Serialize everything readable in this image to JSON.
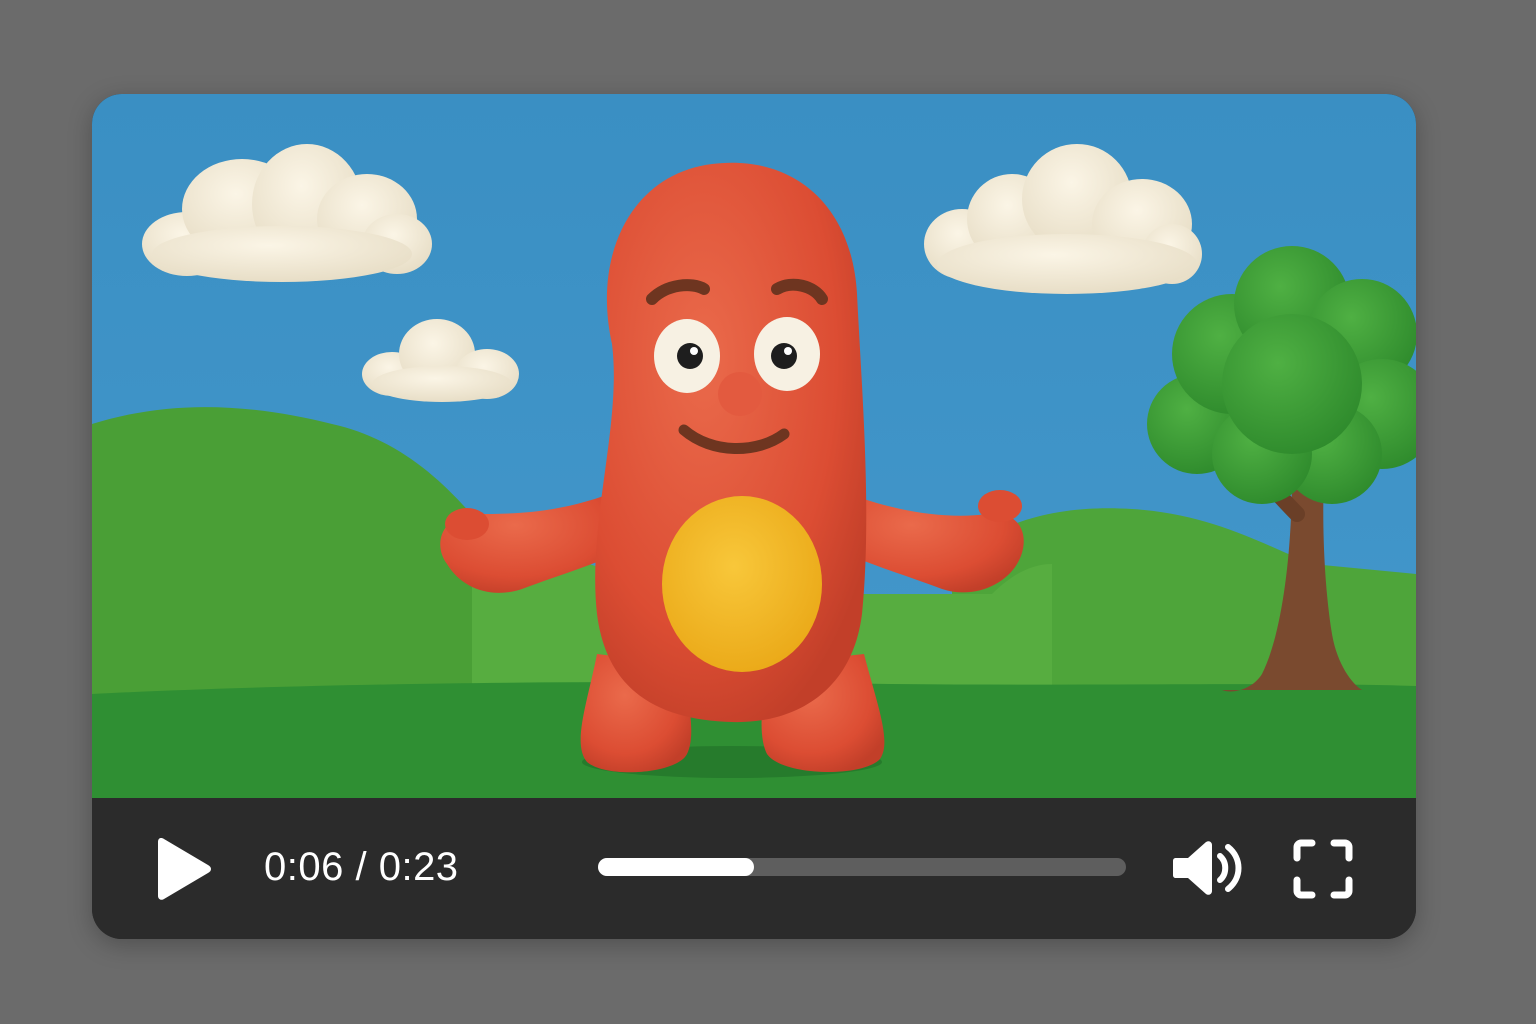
{
  "player": {
    "time": {
      "current": "0:06",
      "separator": " / ",
      "duration": "0:23"
    },
    "progress_fraction": 0.296,
    "controls": {
      "play_icon": "play-icon",
      "volume_icon": "volume-icon",
      "fullscreen_icon": "fullscreen-icon"
    }
  },
  "colors": {
    "page_background": "#6b6b6b",
    "control_bar": "#2b2b2b",
    "progress_track": "#5e5e5e",
    "progress_fill": "#ffffff",
    "sky": "#3d93c6",
    "grass": "#3d9a3a",
    "character": "#e0523a",
    "belly": "#f2b624"
  }
}
